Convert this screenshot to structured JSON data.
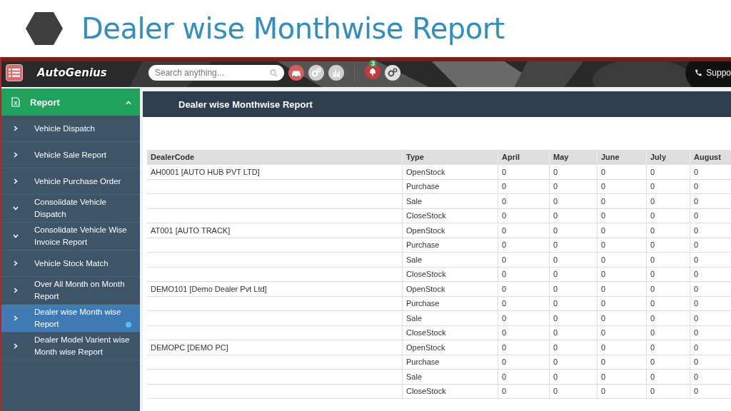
{
  "slide": {
    "title": "Dealer wise Monthwise Report"
  },
  "top_bar": {
    "logo": "AutoGenius",
    "search": {
      "placeholder": "Search anything..."
    },
    "notification_count": "3",
    "support": "Suppo"
  },
  "sidebar": {
    "section": {
      "label": "Report",
      "expanded": true
    },
    "items": [
      {
        "label": "Vehicle Dispatch",
        "expanded": false,
        "selected": false
      },
      {
        "label": "Vehicle Sale Report",
        "expanded": false,
        "selected": false
      },
      {
        "label": "Vehicle Purchase Order",
        "expanded": false,
        "selected": false
      },
      {
        "label": "Consolidate Vehicle Dispatch",
        "expanded": true,
        "selected": false
      },
      {
        "label": "Consolidate Vehicle Wise Invoice Report",
        "expanded": true,
        "selected": false
      },
      {
        "label": "Vehicle Stock Match",
        "expanded": false,
        "selected": false
      },
      {
        "label": "Over All Month on Month Report",
        "expanded": false,
        "selected": false
      },
      {
        "label": "Dealer wise Month wise Report",
        "expanded": false,
        "selected": true
      },
      {
        "label": "Dealer Model Varient wise Month wise Report",
        "expanded": false,
        "selected": false
      }
    ]
  },
  "panel": {
    "title": "Dealer wise Monthwise Report"
  },
  "table": {
    "columns": [
      "DealerCode",
      "Type",
      "April",
      "May",
      "June",
      "July",
      "August"
    ],
    "rows": [
      {
        "dealer": "AH0001 [AUTO HUB PVT LTD]",
        "type": "OpenStock",
        "values": [
          "0",
          "0",
          "0",
          "0",
          "0"
        ]
      },
      {
        "type": "Purchase",
        "values": [
          "0",
          "0",
          "0",
          "0",
          "0"
        ]
      },
      {
        "type": "Sale",
        "values": [
          "0",
          "0",
          "0",
          "0",
          "0"
        ]
      },
      {
        "type": "CloseStock",
        "values": [
          "0",
          "0",
          "0",
          "0",
          "0"
        ]
      },
      {
        "dealer": "AT001 [AUTO TRACK]",
        "type": "OpenStock",
        "values": [
          "0",
          "0",
          "0",
          "0",
          "0"
        ]
      },
      {
        "type": "Purchase",
        "values": [
          "0",
          "0",
          "0",
          "0",
          "0"
        ]
      },
      {
        "type": "Sale",
        "values": [
          "0",
          "0",
          "0",
          "0",
          "0"
        ]
      },
      {
        "type": "CloseStock",
        "values": [
          "0",
          "0",
          "0",
          "0",
          "0"
        ]
      },
      {
        "dealer": "DEMO101 [Demo Dealer Pvt Ltd]",
        "type": "OpenStock",
        "values": [
          "0",
          "0",
          "0",
          "0",
          "0"
        ]
      },
      {
        "type": "Purchase",
        "values": [
          "0",
          "0",
          "0",
          "0",
          "0"
        ]
      },
      {
        "type": "Sale",
        "values": [
          "0",
          "0",
          "0",
          "0",
          "0"
        ]
      },
      {
        "type": "CloseStock",
        "values": [
          "0",
          "0",
          "0",
          "0",
          "0"
        ]
      },
      {
        "dealer": "DEMOPC [DEMO PC]",
        "type": "OpenStock",
        "values": [
          "0",
          "0",
          "0",
          "0",
          "0"
        ]
      },
      {
        "type": "Purchase",
        "values": [
          "0",
          "0",
          "0",
          "0",
          "0"
        ]
      },
      {
        "type": "Sale",
        "values": [
          "0",
          "0",
          "0",
          "0",
          "0"
        ]
      },
      {
        "type": "CloseStock",
        "values": [
          "0",
          "0",
          "0",
          "0",
          "0"
        ]
      }
    ]
  }
}
